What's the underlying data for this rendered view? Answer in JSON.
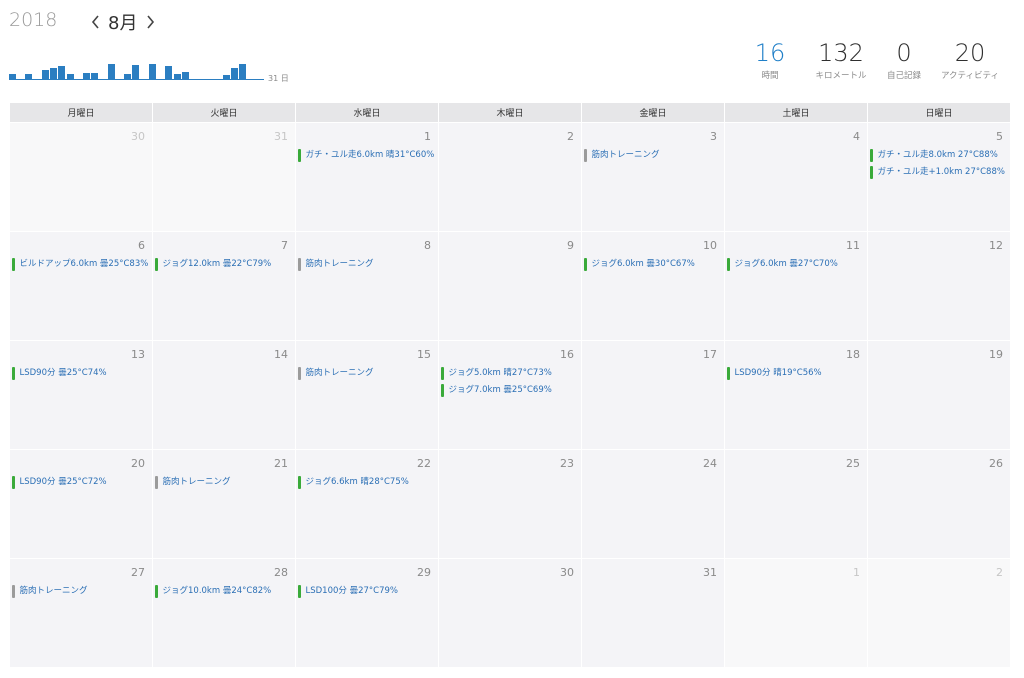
{
  "header": {
    "year": "2018",
    "month": "8月",
    "sparkline_label": "31 日"
  },
  "sparkline": [
    {
      "day": 1,
      "value": 0.3
    },
    {
      "day": 3,
      "value": 0.3
    },
    {
      "day": 5,
      "value": 0.5
    },
    {
      "day": 6,
      "value": 0.6
    },
    {
      "day": 7,
      "value": 0.75
    },
    {
      "day": 8,
      "value": 0.3
    },
    {
      "day": 10,
      "value": 0.35
    },
    {
      "day": 11,
      "value": 0.35
    },
    {
      "day": 13,
      "value": 0.85
    },
    {
      "day": 15,
      "value": 0.3
    },
    {
      "day": 16,
      "value": 0.8
    },
    {
      "day": 18,
      "value": 0.85
    },
    {
      "day": 20,
      "value": 0.75
    },
    {
      "day": 21,
      "value": 0.3
    },
    {
      "day": 22,
      "value": 0.4
    },
    {
      "day": 27,
      "value": 0.25
    },
    {
      "day": 28,
      "value": 0.6
    },
    {
      "day": 29,
      "value": 0.85
    }
  ],
  "stats": [
    {
      "value": "16",
      "label": "時間",
      "accent": true
    },
    {
      "value": "132",
      "label": "キロメートル",
      "accent": false
    },
    {
      "value": "0",
      "label": "自己記録",
      "accent": false
    },
    {
      "value": "20",
      "label": "アクティビティ",
      "accent": false
    }
  ],
  "weekdays": [
    "月曜日",
    "火曜日",
    "水曜日",
    "木曜日",
    "金曜日",
    "土曜日",
    "日曜日"
  ],
  "colors": {
    "run": "#3aaa3a",
    "strength": "#9b9b9b",
    "accent": "#1f7fc8"
  },
  "weeks": [
    [
      {
        "day": "30",
        "dim": true,
        "events": []
      },
      {
        "day": "31",
        "dim": true,
        "events": []
      },
      {
        "day": "1",
        "events": [
          {
            "text": "ガチ・ユル走6.0km 晴31°C60%",
            "type": "run"
          }
        ]
      },
      {
        "day": "2",
        "events": []
      },
      {
        "day": "3",
        "events": [
          {
            "text": "筋肉トレーニング",
            "type": "strength"
          }
        ]
      },
      {
        "day": "4",
        "events": []
      },
      {
        "day": "5",
        "events": [
          {
            "text": "ガチ・ユル走8.0km 27°C88%",
            "type": "run"
          },
          {
            "text": "ガチ・ユル走+1.0km 27°C88%",
            "type": "run"
          }
        ]
      }
    ],
    [
      {
        "day": "6",
        "events": [
          {
            "text": "ビルドアップ6.0km 曇25°C83%",
            "type": "run"
          }
        ]
      },
      {
        "day": "7",
        "events": [
          {
            "text": "ジョグ12.0km 曇22°C79%",
            "type": "run"
          }
        ]
      },
      {
        "day": "8",
        "events": [
          {
            "text": "筋肉トレーニング",
            "type": "strength"
          }
        ]
      },
      {
        "day": "9",
        "events": []
      },
      {
        "day": "10",
        "events": [
          {
            "text": "ジョグ6.0km 曇30°C67%",
            "type": "run"
          }
        ]
      },
      {
        "day": "11",
        "events": [
          {
            "text": "ジョグ6.0km 曇27°C70%",
            "type": "run"
          }
        ]
      },
      {
        "day": "12",
        "events": []
      }
    ],
    [
      {
        "day": "13",
        "events": [
          {
            "text": "LSD90分 曇25°C74%",
            "type": "run"
          }
        ]
      },
      {
        "day": "14",
        "events": []
      },
      {
        "day": "15",
        "events": [
          {
            "text": "筋肉トレーニング",
            "type": "strength"
          }
        ]
      },
      {
        "day": "16",
        "events": [
          {
            "text": "ジョグ5.0km 晴27°C73%",
            "type": "run"
          },
          {
            "text": "ジョグ7.0km 曇25°C69%",
            "type": "run"
          }
        ]
      },
      {
        "day": "17",
        "events": []
      },
      {
        "day": "18",
        "events": [
          {
            "text": "LSD90分 晴19°C56%",
            "type": "run"
          }
        ]
      },
      {
        "day": "19",
        "events": []
      }
    ],
    [
      {
        "day": "20",
        "events": [
          {
            "text": "LSD90分 曇25°C72%",
            "type": "run"
          }
        ]
      },
      {
        "day": "21",
        "events": [
          {
            "text": "筋肉トレーニング",
            "type": "strength"
          }
        ]
      },
      {
        "day": "22",
        "events": [
          {
            "text": "ジョグ6.6km 晴28°C75%",
            "type": "run"
          }
        ]
      },
      {
        "day": "23",
        "events": []
      },
      {
        "day": "24",
        "events": []
      },
      {
        "day": "25",
        "events": []
      },
      {
        "day": "26",
        "events": []
      }
    ],
    [
      {
        "day": "27",
        "events": [
          {
            "text": "筋肉トレーニング",
            "type": "strength"
          }
        ]
      },
      {
        "day": "28",
        "events": [
          {
            "text": "ジョグ10.0km 曇24°C82%",
            "type": "run"
          }
        ]
      },
      {
        "day": "29",
        "events": [
          {
            "text": "LSD100分 曇27°C79%",
            "type": "run"
          }
        ]
      },
      {
        "day": "30",
        "events": []
      },
      {
        "day": "31",
        "events": []
      },
      {
        "day": "1",
        "dim": true,
        "events": []
      },
      {
        "day": "2",
        "dim": true,
        "events": []
      }
    ]
  ]
}
